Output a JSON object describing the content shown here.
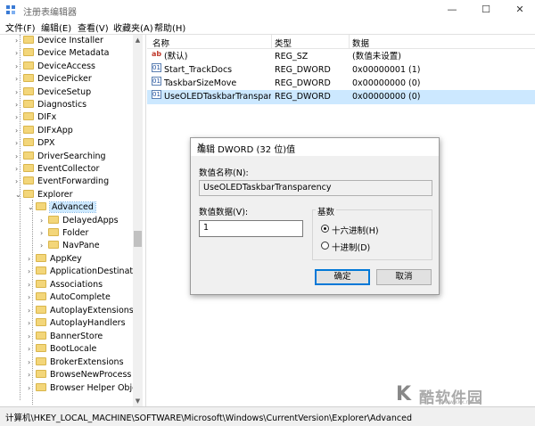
{
  "window": {
    "title": "注册表编辑器",
    "controls": [
      "—",
      "☐",
      "✕"
    ]
  },
  "menu": [
    "文件(F)",
    "编辑(E)",
    "查看(V)",
    "收藏夹(A)",
    "帮助(H)"
  ],
  "tree": {
    "items": [
      {
        "label": "Device Installer"
      },
      {
        "label": "Device Metadata"
      },
      {
        "label": "DeviceAccess"
      },
      {
        "label": "DevicePicker"
      },
      {
        "label": "DeviceSetup"
      },
      {
        "label": "Diagnostics"
      },
      {
        "label": "DIFx"
      },
      {
        "label": "DIFxApp"
      },
      {
        "label": "DPX"
      },
      {
        "label": "DriverSearching"
      },
      {
        "label": "EventCollector"
      },
      {
        "label": "EventForwarding"
      },
      {
        "label": "Explorer"
      },
      {
        "label": "Advanced"
      },
      {
        "label": "DelayedApps"
      },
      {
        "label": "Folder"
      },
      {
        "label": "NavPane"
      },
      {
        "label": "AppKey"
      },
      {
        "label": "ApplicationDestinations"
      },
      {
        "label": "Associations"
      },
      {
        "label": "AutoComplete"
      },
      {
        "label": "AutoplayExtensions"
      },
      {
        "label": "AutoplayHandlers"
      },
      {
        "label": "BannerStore"
      },
      {
        "label": "BootLocale"
      },
      {
        "label": "BrokerExtensions"
      },
      {
        "label": "BrowseNewProcess"
      },
      {
        "label": "Browser Helper Obje"
      }
    ]
  },
  "list": {
    "headers": {
      "name": "名称",
      "type": "类型",
      "data": "数据"
    },
    "rows": [
      {
        "icon": "ab",
        "name": "(默认)",
        "type": "REG_SZ",
        "data": "(数值未设置)"
      },
      {
        "icon": "dword",
        "name": "Start_TrackDocs",
        "type": "REG_DWORD",
        "data": "0x00000001 (1)"
      },
      {
        "icon": "dword",
        "name": "TaskbarSizeMove",
        "type": "REG_DWORD",
        "data": "0x00000000 (0)"
      },
      {
        "icon": "dword",
        "name": "UseOLEDTaskbarTranspar...",
        "type": "REG_DWORD",
        "data": "0x00000000 (0)"
      }
    ]
  },
  "dialog": {
    "title": "编辑 DWORD (32 位)值",
    "close": "✕",
    "name_label": "数值名称(N):",
    "name_value": "UseOLEDTaskbarTransparency",
    "data_label": "数值数据(V):",
    "data_value": "1",
    "base_label": "基数",
    "hex_label": "十六进制(H)",
    "dec_label": "十进制(D)",
    "ok": "确定",
    "cancel": "取消"
  },
  "status": "计算机\\HKEY_LOCAL_MACHINE\\SOFTWARE\\Microsoft\\Windows\\CurrentVersion\\Explorer\\Advanced",
  "watermark": {
    "k": "K",
    "text": "酷软件园",
    "url": "www.kkx.net"
  }
}
